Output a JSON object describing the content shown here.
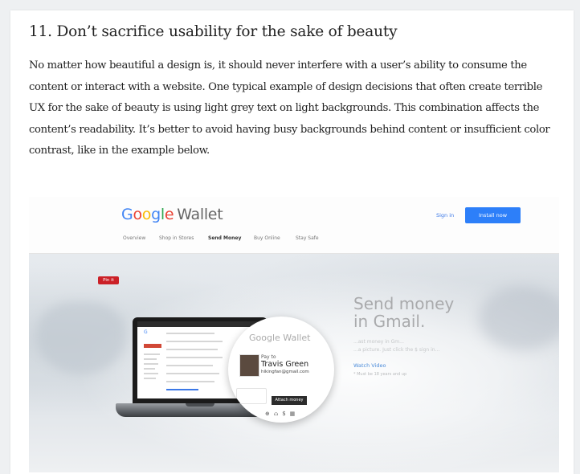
{
  "article": {
    "heading": "11. Don’t sacrifice usability for the sake of beauty",
    "paragraph": "No matter how beautiful a design is, it should never interfere with a user’s ability to consume the content or interact with a website. One typical example of design decisions that often create terrible UX for the sake of beauty is using light grey text on light backgrounds. This combination affects the content’s readability. It’s better to avoid having busy backgrounds behind content or insufficient color contrast, like in the example below."
  },
  "example": {
    "logo": {
      "letters": [
        "G",
        "o",
        "o",
        "g",
        "l",
        "e"
      ],
      "product": "Wallet"
    },
    "sign_in": "Sign in",
    "install_now": "Install now",
    "nav": [
      "Overview",
      "Shop in Stores",
      "Send Money",
      "Buy Online",
      "Stay Safe"
    ],
    "nav_active": "Send Money",
    "pin_label": "Pin it",
    "bubble": {
      "logo": "Google Wallet",
      "pay_to": "Pay to",
      "name": "Travis Green",
      "email": "hikingfan@gmail.com",
      "attach": "Attach money"
    },
    "headline_line1": "Send money",
    "headline_line2": "in Gmail.",
    "faint_line1": "...ast money in Gm...",
    "faint_line2": "...a picture. Just click the $ sign in...",
    "watch_video": "Watch Video",
    "fine_print": "* Must be 18 years and up"
  },
  "colors": {
    "link_blue": "#3b78e7",
    "install_blue": "#2d7ff9",
    "headline_grey": "#a9aaac",
    "gmail_red": "#d14836"
  }
}
